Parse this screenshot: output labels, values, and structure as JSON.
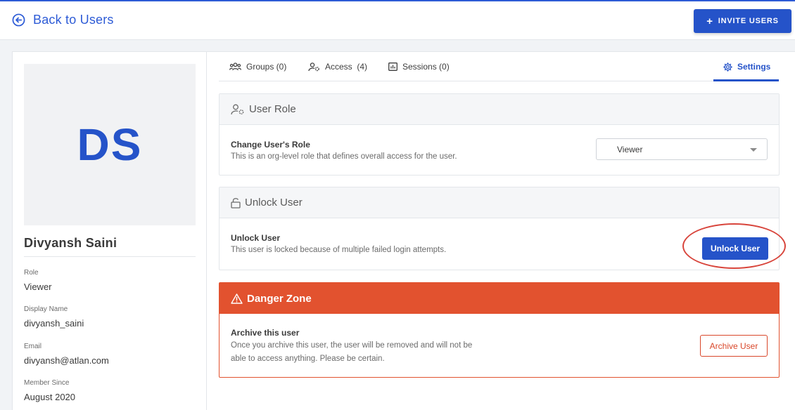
{
  "header": {
    "back_label": "Back to Users",
    "invite_label": "INVITE USERS",
    "invite_plus": "+"
  },
  "profile": {
    "initials": "DS",
    "name": "Divyansh Saini",
    "fields": [
      {
        "label": "Role",
        "value": "Viewer"
      },
      {
        "label": "Display Name",
        "value": "divyansh_saini"
      },
      {
        "label": "Email",
        "value": "divyansh@atlan.com"
      },
      {
        "label": "Member Since",
        "value": "August 2020"
      }
    ]
  },
  "tabs": [
    {
      "label": "Groups (0)",
      "icon": "groups-icon"
    },
    {
      "label": "Access  (4)",
      "icon": "access-icon"
    },
    {
      "label": "Sessions (0)",
      "icon": "sessions-icon"
    },
    {
      "label": "Settings",
      "icon": "gear-icon",
      "active": true
    }
  ],
  "user_role": {
    "heading": "User Role",
    "title": "Change User's Role",
    "description": "This is an org-level role that defines overall access for the user.",
    "selected_role": "Viewer"
  },
  "unlock": {
    "heading": "Unlock User",
    "title": "Unlock User",
    "description": "This user is locked because of multiple failed login attempts.",
    "button_label": "Unlock User"
  },
  "danger": {
    "heading": "Danger Zone",
    "title": "Archive this user",
    "description_line1": "Once you archive this user, the user will be removed and will not be",
    "description_line2": "able to access anything. Please be certain.",
    "button_label": "Archive User"
  },
  "colors": {
    "accent": "#2553c9",
    "danger": "#e2522f",
    "annotation": "#d8453c"
  }
}
